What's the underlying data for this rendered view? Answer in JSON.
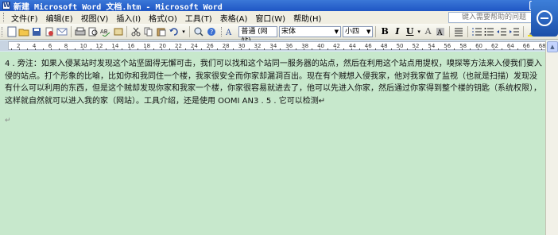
{
  "window": {
    "title": "新建 Microsoft Word 文档.htm - Microsoft Word",
    "minimize": "_",
    "restore": "❐"
  },
  "menu": {
    "items": [
      "文件(F)",
      "编辑(E)",
      "视图(V)",
      "插入(I)",
      "格式(O)",
      "工具(T)",
      "表格(A)",
      "窗口(W)",
      "帮助(H)"
    ],
    "help_placeholder": "键入需要帮助的问题"
  },
  "toolbar": {
    "style": "普通 (网站)",
    "font": "宋体",
    "size": "小四",
    "bold": "B",
    "italic": "I",
    "underline": "U",
    "font_color_a": "A"
  },
  "ruler": {
    "numbers": [
      "2",
      "4",
      "6",
      "8",
      "10",
      "12",
      "14",
      "16",
      "18",
      "20",
      "22",
      "24",
      "26",
      "28",
      "30",
      "32",
      "34",
      "36",
      "38",
      "40",
      "42",
      "44",
      "46",
      "48",
      "50",
      "52",
      "54",
      "56",
      "58",
      "60",
      "62",
      "64",
      "66",
      "68"
    ]
  },
  "document": {
    "body": "4 . 旁注：如果入侵某站时发现这个站坚固得无懈可击，我们可以找和这个站同一服务器的站点，然后在利用这个站点用提权，嗅探等方法来入侵我们要入侵的站点。打个形象的比喻，比如你和我同住一个楼，我家很安全而你家却漏洞百出。现在有个贼想入侵我家，他对我家做了监视（也就是扫描）发现没有什么可以利用的东西，但是这个贼却发现你家和我家一个楼，你家很容易就进去了，他可以先进入你家，然后通过你家得到整个楼的钥匙（系统权限），这样就自然就可以进入我的家（网站）。工具介绍，还是使用 OOMI AN3 . 5 . 它可以检测↵",
    "paragraph_mark": "↵"
  },
  "colors": {
    "titlebar": "#2a63cc",
    "doc_background": "#c7e8cc",
    "menubar": "#f0eee2"
  }
}
